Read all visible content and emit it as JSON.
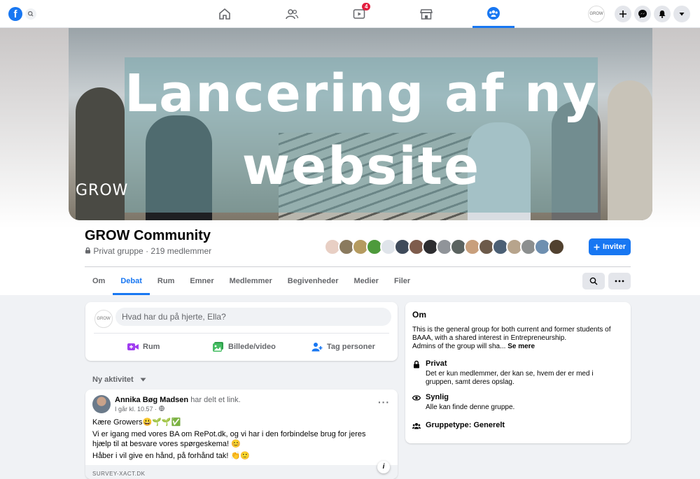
{
  "topbar": {
    "logo": "f",
    "nav": [
      {
        "icon": "home-icon"
      },
      {
        "icon": "friends-icon"
      },
      {
        "icon": "watch-icon",
        "badge": "4"
      },
      {
        "icon": "marketplace-icon"
      },
      {
        "icon": "groups-icon",
        "active": true
      }
    ],
    "profile_label": "GROW",
    "actions": [
      "plus-icon",
      "messenger-icon",
      "notifications-icon",
      "account-menu-icon"
    ]
  },
  "cover": {
    "headline": "Lancering af ny website",
    "watermark": "GROW"
  },
  "group": {
    "name": "GROW Community",
    "privacy": "Privat gruppe",
    "separator": "·",
    "members": "219 medlemmer",
    "invite_label": "Inviter"
  },
  "tabs": [
    "Om",
    "Debat",
    "Rum",
    "Emner",
    "Medlemmer",
    "Begivenheder",
    "Medier",
    "Filer"
  ],
  "active_tab": "Debat",
  "composer": {
    "avatar_label": "GROW",
    "placeholder": "Hvad har du på hjerte, Ella?",
    "actions": [
      {
        "label": "Rum",
        "icon": "video-room-icon",
        "color": "#a03cf0"
      },
      {
        "label": "Billede/video",
        "icon": "photo-icon",
        "color": "#45bd62"
      },
      {
        "label": "Tag personer",
        "icon": "tag-people-icon",
        "color": "#1877f2"
      }
    ]
  },
  "feed": {
    "sort_label": "Ny aktivitet",
    "post": {
      "author": "Annika Bøg Madsen",
      "action": "har delt et link.",
      "time": "I går kl. 10.57 ·",
      "lines": [
        "Kære Growers😃🌱🌱✅",
        "Vi er igang med vores BA om RePot.dk, og vi har i den forbindelse brug for jeres hjælp til at besvare vores spørgeskema! 😊",
        "Håber i vil give en hånd, på forhånd tak! 👏🙂"
      ],
      "link_domain": "SURVEY-XACT.DK"
    }
  },
  "about": {
    "title": "Om",
    "description": "This is the general group for both current and former students of BAAA, with a shared interest in Entrepreneurship.",
    "description_more": "Admins of the group will sha...",
    "see_more": "Se mere",
    "items": [
      {
        "icon": "lock-icon",
        "title": "Privat",
        "text": "Det er kun medlemmer, der kan se, hvem der er med i gruppen, samt deres opslag."
      },
      {
        "icon": "eye-icon",
        "title": "Synlig",
        "text": "Alle kan finde denne gruppe."
      },
      {
        "icon": "group-type-icon",
        "title": "Gruppetype: Generelt",
        "text": ""
      }
    ]
  },
  "colors": {
    "accent": "#1877f2",
    "badge": "#e41e3f",
    "page_bg": "#f0f2f5"
  }
}
